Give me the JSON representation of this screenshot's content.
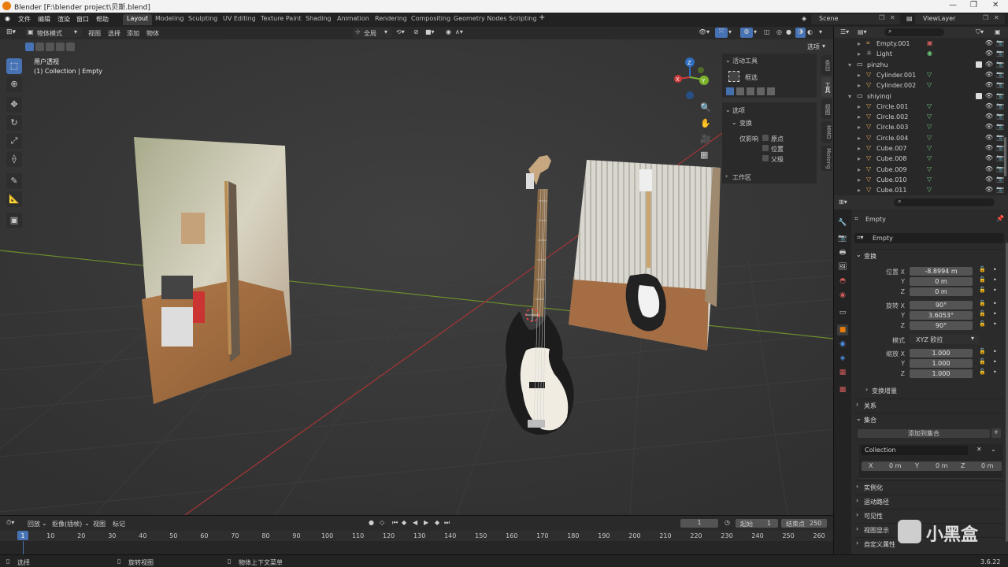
{
  "titlebar": {
    "title": "Blender [F:\\blender project\\贝斯.blend]"
  },
  "menus": [
    "文件",
    "编辑",
    "渲染",
    "窗口",
    "帮助"
  ],
  "workspaces": [
    {
      "label": "Layout",
      "active": true
    },
    {
      "label": "Modeling"
    },
    {
      "label": "Sculpting"
    },
    {
      "label": "UV Editing"
    },
    {
      "label": "Texture Paint"
    },
    {
      "label": "Shading"
    },
    {
      "label": "Animation"
    },
    {
      "label": "Rendering"
    },
    {
      "label": "Compositing"
    },
    {
      "label": "Geometry Nodes"
    },
    {
      "label": "Scripting"
    }
  ],
  "topright": {
    "scene": "Scene",
    "viewlayer": "ViewLayer"
  },
  "viewport_header": {
    "mode": "物体模式",
    "view": "视图",
    "select": "选择",
    "add": "添加",
    "object": "物体",
    "transform_orient": "全局",
    "options": "选项"
  },
  "viewport": {
    "view_name": "用户透视",
    "collection_info": "(1) Collection | Empty"
  },
  "npanel": {
    "active_tool": "活动工具",
    "tool_name": "框选",
    "options": "选项",
    "transform": "变换",
    "affect_only": "仅影响",
    "origin": "原点",
    "location": "位置",
    "parents": "父级",
    "workspace": "工作区",
    "tabs": [
      "条目",
      "工具",
      "视图",
      "MMD",
      "Motorig"
    ]
  },
  "outliner": {
    "rows": [
      {
        "name": "Empty.001",
        "indent": 2,
        "type": "empty"
      },
      {
        "name": "Light",
        "indent": 2,
        "type": "light"
      },
      {
        "name": "pinzhu",
        "indent": 1,
        "type": "collection"
      },
      {
        "name": "Cylinder.001",
        "indent": 2,
        "type": "mesh"
      },
      {
        "name": "Cylinder.002",
        "indent": 2,
        "type": "mesh"
      },
      {
        "name": "shiyinqi",
        "indent": 1,
        "type": "collection"
      },
      {
        "name": "Circle.001",
        "indent": 2,
        "type": "mesh"
      },
      {
        "name": "Circle.002",
        "indent": 2,
        "type": "mesh"
      },
      {
        "name": "Circle.003",
        "indent": 2,
        "type": "mesh"
      },
      {
        "name": "Circle.004",
        "indent": 2,
        "type": "mesh"
      },
      {
        "name": "Cube.007",
        "indent": 2,
        "type": "mesh"
      },
      {
        "name": "Cube.008",
        "indent": 2,
        "type": "mesh"
      },
      {
        "name": "Cube.009",
        "indent": 2,
        "type": "mesh"
      },
      {
        "name": "Cube.010",
        "indent": 2,
        "type": "mesh"
      },
      {
        "name": "Cube.011",
        "indent": 2,
        "type": "mesh"
      }
    ]
  },
  "properties": {
    "object_name": "Empty",
    "object_field": "Empty",
    "transform_title": "变换",
    "location_label": "位置 X",
    "loc": [
      "-8.8994 m",
      "0 m",
      "0 m"
    ],
    "rotation_label": "旋转 X",
    "rot": [
      "90°",
      "3.6053°",
      "90°"
    ],
    "mode_label": "模式",
    "mode_value": "XYZ 欧拉",
    "scale_label": "缩放 X",
    "scale": [
      "1.000",
      "1.000",
      "1.000"
    ],
    "y": "Y",
    "z": "Z",
    "delta": "变换增量",
    "relations": "关系",
    "collections": "集合",
    "add_to_collection": "添加到集合",
    "collection_name": "Collection",
    "offset": {
      "x_label": "X",
      "x": "0 m",
      "y_label": "Y",
      "y": "0 m",
      "z_label": "Z",
      "z": "0 m"
    },
    "instancing": "实例化",
    "motion_paths": "运动路径",
    "visibility": "可见性",
    "viewport_display": "视图显示",
    "custom_props": "自定义属性"
  },
  "timeline": {
    "playback": "回放",
    "keying": "抠像(插帧)",
    "view": "视图",
    "marker": "标记",
    "current_frame": "1",
    "start_label": "起始",
    "start": "1",
    "end_label": "结束点",
    "end": "250",
    "ticks": [
      "1",
      "10",
      "20",
      "30",
      "40",
      "50",
      "60",
      "70",
      "80",
      "90",
      "100",
      "110",
      "120",
      "130",
      "140",
      "150",
      "160",
      "170",
      "180",
      "190",
      "200",
      "210",
      "220",
      "230",
      "240",
      "250",
      "260"
    ]
  },
  "statusbar": {
    "select": "选择",
    "rotate": "旋转视图",
    "context": "物体上下文菜单",
    "version": "3.6.22"
  },
  "watermark": "小黑盒"
}
